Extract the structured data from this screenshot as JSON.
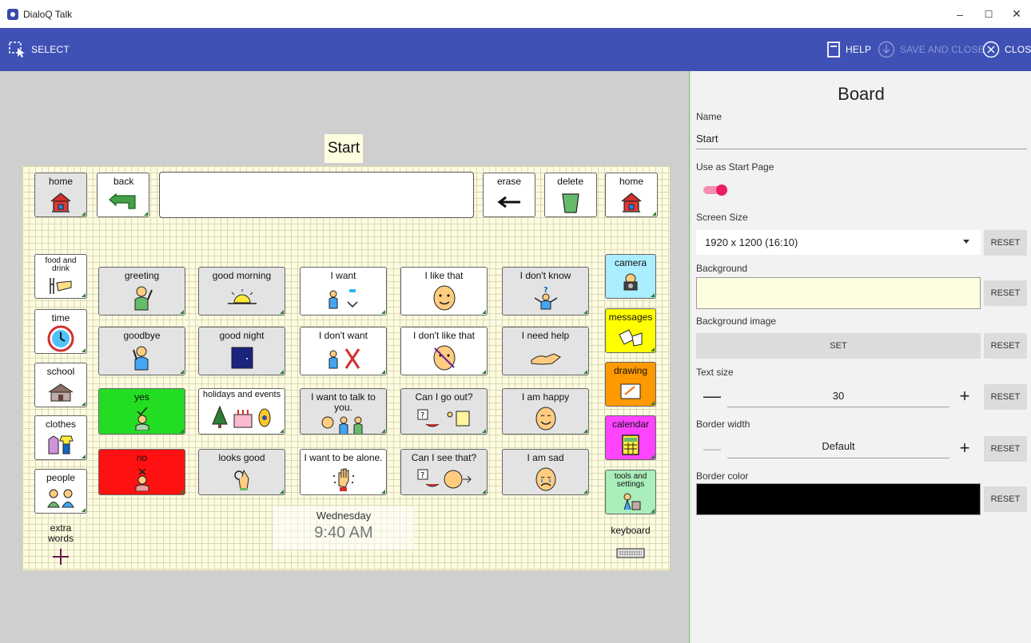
{
  "window": {
    "title": "DialoQ Talk",
    "minimize": "–",
    "maximize": "☐",
    "close": "✕"
  },
  "toolbar": {
    "select_label": "SELECT",
    "help_label": "HELP",
    "save_close_label": "SAVE AND CLOSE",
    "close_label": "CLOSE",
    "color": "#3f51b5"
  },
  "board": {
    "page_name": "Start",
    "background_color": "#fdfbe0",
    "top_row": {
      "home_left": "home",
      "back": "back",
      "erase": "erase",
      "delete": "delete",
      "home_right": "home"
    },
    "left_column": [
      "food and drink",
      "time",
      "school",
      "clothes",
      "people",
      "extra words"
    ],
    "right_column": [
      "camera",
      "messages",
      "drawing",
      "calendar",
      "tools and settings",
      "keyboard"
    ],
    "grid": [
      [
        "greeting",
        "good morning",
        "I want",
        "I like that",
        "I don't know"
      ],
      [
        "goodbye",
        "good night",
        "I don't want",
        "I don't like that",
        "I need help"
      ],
      [
        "yes",
        "holidays and events",
        "I want to talk to you.",
        "Can I go out?",
        "I am happy"
      ],
      [
        "no",
        "looks good",
        "I want to be alone.",
        "Can I see that?",
        "I am sad"
      ]
    ],
    "clock": {
      "day": "Wednesday",
      "time": "9:40 AM"
    },
    "colors": {
      "yes": "#22dd22",
      "no": "#ff1111",
      "camera": "#aaeeff",
      "messages": "#ffff00",
      "drawing": "#ff9900",
      "calendar": "#ff44ff",
      "tools": "#aaeebb"
    }
  },
  "panel": {
    "heading": "Board",
    "name_label": "Name",
    "name_value": "Start",
    "start_page_label": "Use as Start Page",
    "start_page_on": true,
    "screen_size_label": "Screen Size",
    "screen_size_value": "1920 x 1200 (16:10)",
    "background_label": "Background",
    "background_color": "#fffde0",
    "background_image_label": "Background image",
    "set_label": "SET",
    "text_size_label": "Text size",
    "text_size_value": "30",
    "border_width_label": "Border width",
    "border_width_value": "Default",
    "border_color_label": "Border color",
    "border_color": "#000000",
    "reset_label": "RESET",
    "minus": "—",
    "plus": "+"
  }
}
